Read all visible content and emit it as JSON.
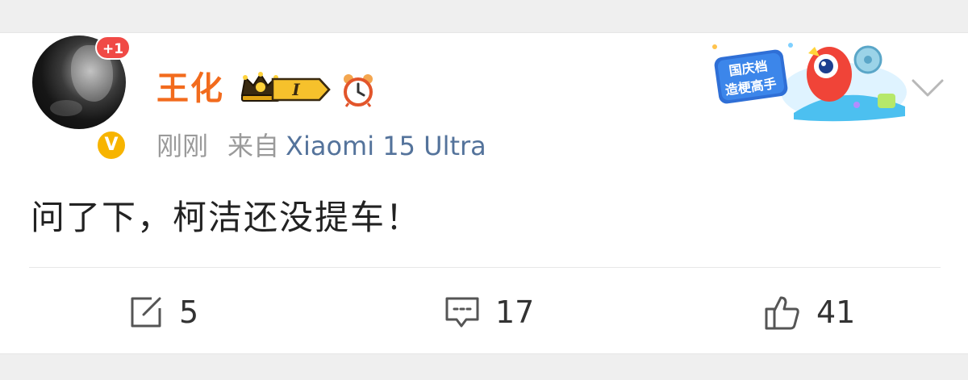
{
  "post": {
    "avatar_badge": "+1",
    "verified_badge": "V",
    "username": "王化",
    "level_badge": "I",
    "time": "刚刚",
    "source_prefix": "来自",
    "device": "Xiaomi 15 Ultra",
    "sticker_line1": "国庆档",
    "sticker_line2": "造梗高手",
    "text": "问了下，柯洁还没提车！"
  },
  "actions": {
    "repost_count": "5",
    "comment_count": "17",
    "like_count": "41"
  },
  "icons": {
    "repost": "share-edit-icon",
    "comment": "comment-bubble-icon",
    "like": "thumbs-up-icon",
    "menu": "chevron-down-icon",
    "crown": "crown-icon",
    "clock": "alarm-clock-icon"
  },
  "colors": {
    "username": "#f26b1d",
    "device": "#54739b",
    "meta": "#9a9a9a",
    "badge_red": "#f04a46",
    "badge_gold": "#f7b400"
  }
}
